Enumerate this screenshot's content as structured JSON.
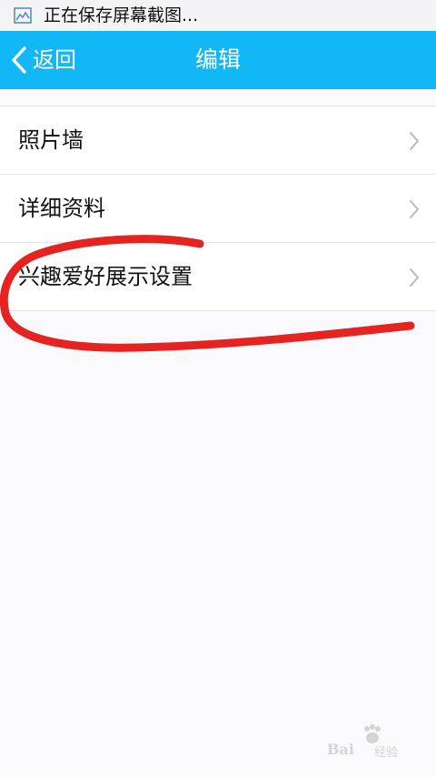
{
  "status_bar": {
    "notification_text": "正在保存屏幕截图...",
    "icon": "screenshot-icon"
  },
  "nav_bar": {
    "back_label": "返回",
    "title": "编辑",
    "background_color": "#12b7f5"
  },
  "list": {
    "items": [
      {
        "label": "照片墙"
      },
      {
        "label": "详细资料"
      },
      {
        "label": "兴趣爱好展示设置"
      }
    ]
  },
  "annotation": {
    "color": "#e52421",
    "shape": "hand-drawn-circle"
  },
  "watermark": {
    "brand": "Bai",
    "suffix": "经验"
  }
}
